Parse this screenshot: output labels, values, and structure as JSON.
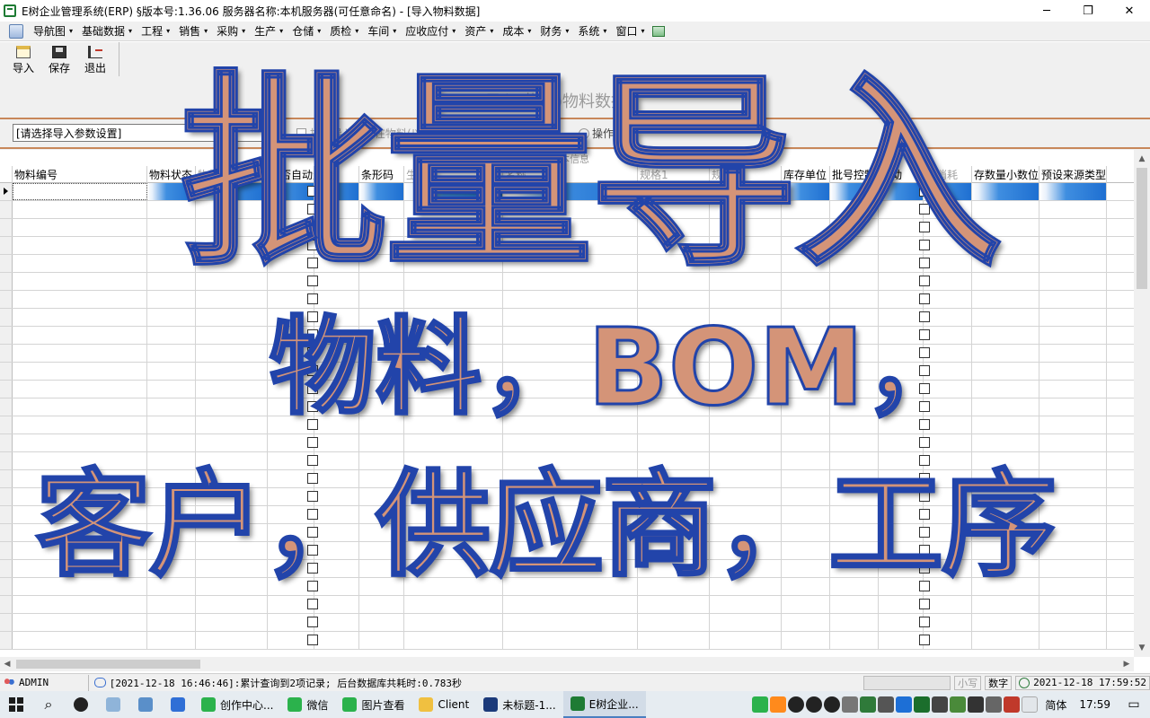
{
  "window": {
    "title": "E树企业管理系统(ERP) §版本号:1.36.06  服务器名称:本机服务器(可任意命名) - [导入物料数据]",
    "min": "─",
    "restore": "❐",
    "close": "✕"
  },
  "menu": {
    "items": [
      "导航图",
      "基础数据",
      "工程",
      "销售",
      "采购",
      "生产",
      "仓储",
      "质检",
      "车间",
      "应收应付",
      "资产",
      "成本",
      "财务",
      "系统",
      "窗口"
    ],
    "caret": "▾"
  },
  "toolbar": {
    "import_label": "导入",
    "save_label": "保存",
    "exit_label": "退出"
  },
  "form": {
    "title": "导入(物料)物料数据",
    "param_placeholder": "[请选择导入参数设置]",
    "batch_label": "批量导入已存在物料(以便在原物料基础上修改)",
    "hint_label": "操作提示",
    "band_label": "基本信息"
  },
  "grid": {
    "columns": [
      "物料编号",
      "物料状态",
      "物料",
      "是否自动生",
      "型号",
      "条形码",
      "生产商",
      "名称",
      "规格1",
      "规格2",
      "库存单位",
      "批号控制",
      "自动",
      "的消耗",
      "存数量小数位",
      "预设来源类型"
    ],
    "row_count": 26
  },
  "status": {
    "user": "ADMIN",
    "message": "[2021-12-18 16:46:46]:累计查询到2项记录; 后台数据库共耗时:0.783秒",
    "caps": "小写",
    "num": "数字",
    "datetime": "2021-12-18  17:59:52"
  },
  "taskbar": {
    "tasks": [
      {
        "label": "创作中心...",
        "color": "#2bb24c"
      },
      {
        "label": "微信",
        "color": "#2bb24c"
      },
      {
        "label": "图片查看",
        "color": "#2bb24c"
      },
      {
        "label": "Client",
        "color": "#f0c040"
      },
      {
        "label": "未标题-1...",
        "color": "#1b3a7a"
      },
      {
        "label": "E树企业...",
        "color": "#1e7b34"
      }
    ],
    "ime": "简体",
    "time": "17:59"
  },
  "overlay": {
    "line1": "批量导入",
    "line2": "物料，BOM，",
    "line3": "客户，供应商，工序"
  },
  "colors": {
    "overlay_fill": "#d49478",
    "overlay_stroke": "#2244aa",
    "accent_orange_line": "#c8875a",
    "selection_blue": "#1e6fd1"
  }
}
